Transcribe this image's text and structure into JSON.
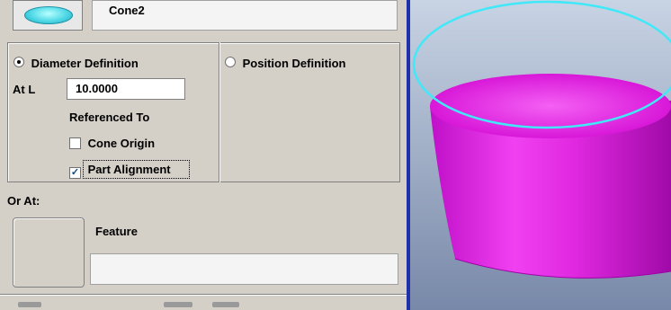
{
  "feature": {
    "icon": "cone-icon",
    "name": "Cone2"
  },
  "definition": {
    "diameter_label": "Diameter Definition",
    "position_label": "Position Definition",
    "selected": "diameter",
    "at_l_label": "At L",
    "at_l_value": "10.0000",
    "referenced_to_label": "Referenced To",
    "cone_origin_label": "Cone Origin",
    "cone_origin_checked": false,
    "part_alignment_label": "Part Alignment",
    "part_alignment_checked": true
  },
  "or_at": {
    "label": "Or At:",
    "feature_label": "Feature",
    "feature_value": ""
  },
  "viewport": {
    "cone_color": "#e020e0",
    "circle_color": "#40e8f8",
    "background_top": "#c8d4e4",
    "background_bottom": "#7888a8"
  },
  "colors": {
    "panel_bg": "#d4d0c8",
    "viewport_border": "#2030a8"
  }
}
